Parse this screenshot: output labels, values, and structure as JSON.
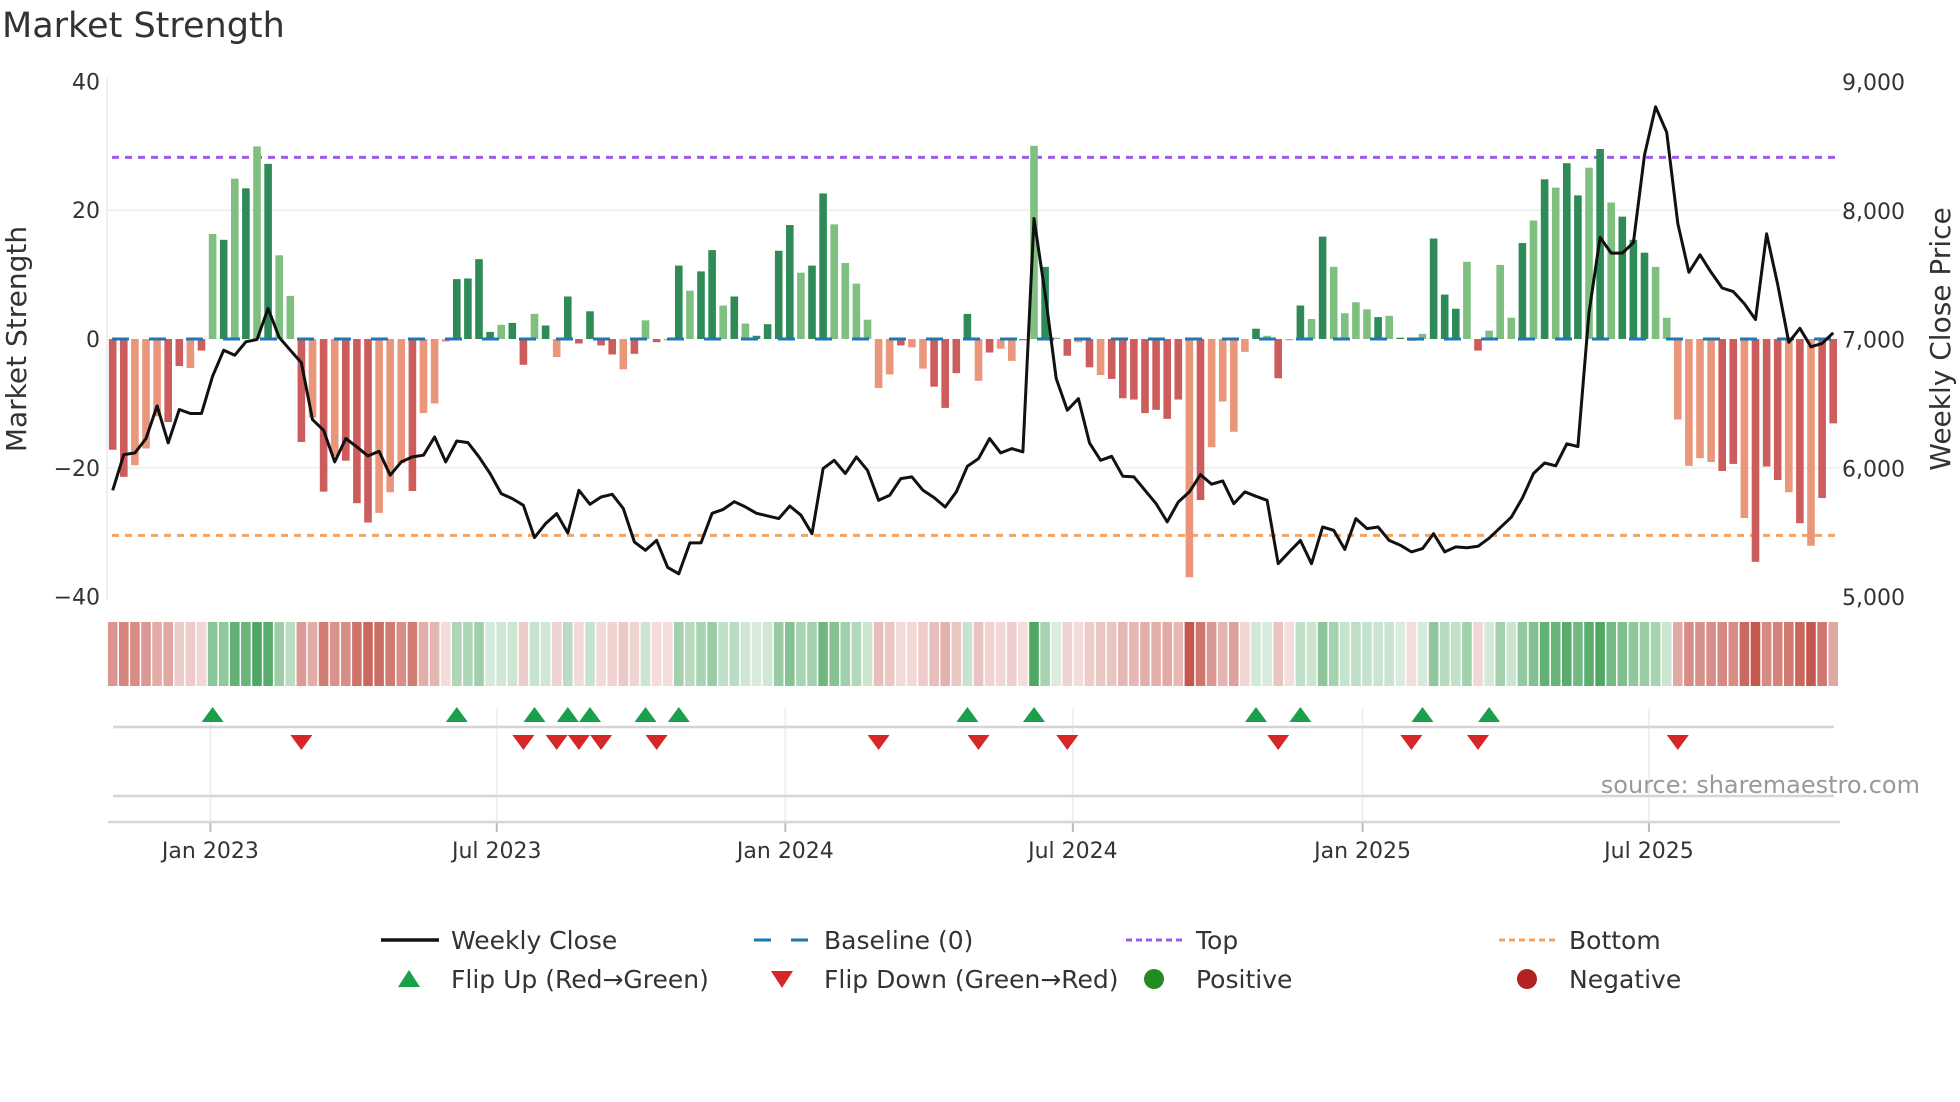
{
  "chart_data": {
    "type": "bar",
    "title": "Market Strength",
    "ylabel": "Market Strength",
    "y2label": "Weekly Close Price",
    "ylim": [
      -40,
      40
    ],
    "y2lim": [
      5000,
      9000
    ],
    "yticks": [
      "40",
      "20",
      "0",
      "−20",
      "−40"
    ],
    "yticks_values": [
      40,
      20,
      0,
      -20,
      -40
    ],
    "y2ticks": [
      "9,000",
      "8,000",
      "7,000",
      "6,000",
      "5,000"
    ],
    "y2ticks_values": [
      9000,
      8000,
      7000,
      6000,
      5000
    ],
    "x_unit": "week index (weekly, ~Nov 2022 to Oct 2025)",
    "xticks": [
      {
        "label": "Jan 2023",
        "week": 8.8
      },
      {
        "label": "Jul 2023",
        "week": 34.6
      },
      {
        "label": "Jan 2024",
        "week": 60.6
      },
      {
        "label": "Jul 2024",
        "week": 86.5
      },
      {
        "label": "Jan 2025",
        "week": 112.6
      },
      {
        "label": "Jul 2025",
        "week": 138.4
      }
    ],
    "top_level": 28.2,
    "bottom_level": -30.5,
    "baseline": 0,
    "strength": [
      -17.2,
      -21.4,
      -19.6,
      -17,
      -12,
      -12.9,
      -4.2,
      -4.5,
      -1.8,
      16.3,
      15.4,
      24.9,
      23.4,
      29.9,
      27.2,
      13,
      6.7,
      -16,
      -12.2,
      -23.7,
      -18.2,
      -18.9,
      -25.5,
      -28.5,
      -27,
      -23.8,
      -19.3,
      -23.6,
      -11.5,
      -10,
      -0.4,
      9.3,
      9.4,
      12.4,
      1.1,
      2.2,
      2.5,
      -4,
      3.9,
      2.1,
      -2.8,
      6.6,
      -0.7,
      4.3,
      -1,
      -2.4,
      -4.7,
      -2.3,
      2.9,
      -0.5,
      -0.2,
      11.4,
      7.5,
      10.5,
      13.8,
      5.2,
      6.6,
      2.4,
      0.5,
      2.3,
      13.7,
      17.7,
      10.3,
      11.4,
      22.6,
      17.8,
      11.8,
      8.6,
      3,
      -7.6,
      -5.5,
      -1,
      -1.3,
      -4.6,
      -7.4,
      -10.7,
      -5.3,
      3.9,
      -6.5,
      -2.1,
      -1.5,
      -3.4,
      -0.2,
      30,
      11.2,
      0.2,
      -2.6,
      -0.5,
      -4.4,
      -5.6,
      -6.2,
      -9.2,
      -9.4,
      -11.5,
      -11,
      -12.4,
      -9.4,
      -37,
      -25,
      -16.8,
      -9.7,
      -14.4,
      -2,
      1.6,
      0.5,
      -6.1,
      -0.2,
      5.2,
      3.1,
      15.9,
      11.2,
      4,
      5.7,
      4.6,
      3.4,
      3.6,
      0.2,
      -0.3,
      0.8,
      15.6,
      6.9,
      4.7,
      12,
      -1.8,
      1.3,
      11.5,
      3.3,
      14.9,
      18.4,
      24.8,
      23.5,
      27.3,
      22.3,
      26.6,
      29.5,
      21.2,
      19,
      15.4,
      13.4,
      11.2,
      3.3,
      -12.5,
      -19.7,
      -18.5,
      -19.1,
      -20.5,
      -19.4,
      -27.8,
      -34.6,
      -19.8,
      -21.9,
      -23.8,
      -28.6,
      -32.1,
      -24.7,
      -13.1
    ],
    "shade": "ddlllddldldldldlldldldddllldlllddddlddldldddddldldldlddldlddddlddlllllldllddddldlldldldldldddddddldlllldldldldlllldldlldddldllldldlddldldddllllllddldddldlddddll",
    "weekly_close": [
      5829,
      6106,
      6119,
      6231,
      6484,
      6197,
      6456,
      6425,
      6425,
      6715,
      6917,
      6878,
      6982,
      7000,
      7241,
      7016,
      6917,
      6819,
      6378,
      6295,
      6049,
      6231,
      6166,
      6096,
      6132,
      5946,
      6049,
      6088,
      6101,
      6243,
      6049,
      6212,
      6199,
      6088,
      5959,
      5803,
      5764,
      5712,
      5461,
      5570,
      5648,
      5497,
      5829,
      5720,
      5777,
      5798,
      5687,
      5427,
      5363,
      5440,
      5230,
      5180,
      5420,
      5420,
      5650,
      5680,
      5740,
      5700,
      5650,
      5630,
      5609,
      5707,
      5635,
      5492,
      5997,
      6062,
      5959,
      6088,
      5984,
      5751,
      5790,
      5920,
      5933,
      5829,
      5772,
      5699,
      5816,
      6016,
      6075,
      6231,
      6119,
      6153,
      6127,
      7940,
      7357,
      6697,
      6451,
      6541,
      6197,
      6062,
      6093,
      5938,
      5933,
      5829,
      5725,
      5583,
      5738,
      5816,
      5951,
      5876,
      5902,
      5725,
      5816,
      5782,
      5751,
      5259,
      5350,
      5440,
      5259,
      5544,
      5518,
      5370,
      5609,
      5531,
      5544,
      5440,
      5402,
      5350,
      5376,
      5492,
      5350,
      5389,
      5383,
      5394,
      5457,
      5538,
      5620,
      5769,
      5959,
      6041,
      6019,
      6190,
      6168,
      7209,
      7793,
      7671,
      7671,
      7753,
      8432,
      8807,
      8609,
      7902,
      7522,
      7658,
      7522,
      7400,
      7372,
      7277,
      7155,
      7821,
      7427,
      6978,
      7087,
      6943,
      6970,
      7052
    ],
    "flip_up_weeks": [
      9,
      31,
      38,
      41,
      43,
      48,
      51,
      77,
      83,
      103,
      107,
      118,
      124
    ],
    "flip_down_weeks": [
      17,
      37,
      40,
      42,
      44,
      49,
      69,
      78,
      86,
      105,
      117,
      123,
      141
    ],
    "legend": {
      "placement": "bottom-center",
      "items": [
        {
          "label": "Weekly Close",
          "kind": "line"
        },
        {
          "label": "Baseline (0)",
          "kind": "dash"
        },
        {
          "label": "Top",
          "kind": "dot-purple"
        },
        {
          "label": "Bottom",
          "kind": "dot-orange"
        },
        {
          "label": "Flip Up (Red→Green)",
          "kind": "tri-up"
        },
        {
          "label": "Flip Down (Green→Red)",
          "kind": "tri-down"
        },
        {
          "label": "Positive",
          "kind": "circle-pos"
        },
        {
          "label": "Negative",
          "kind": "circle-neg"
        }
      ]
    },
    "source": "source: sharemaestro.com",
    "colors": {
      "pos_dark": "#2e8b57",
      "pos_light": "#7fbf7f",
      "neg_dark": "#cd5c5c",
      "neg_light": "#e9967a",
      "baseline": "#1f77b4",
      "top": "#9b5de5",
      "bottom": "#f4a460",
      "flip_up": "#1a9f4b",
      "flip_down": "#d62728",
      "positive": "#228b22",
      "negative": "#b22222",
      "line": "#111111"
    }
  }
}
